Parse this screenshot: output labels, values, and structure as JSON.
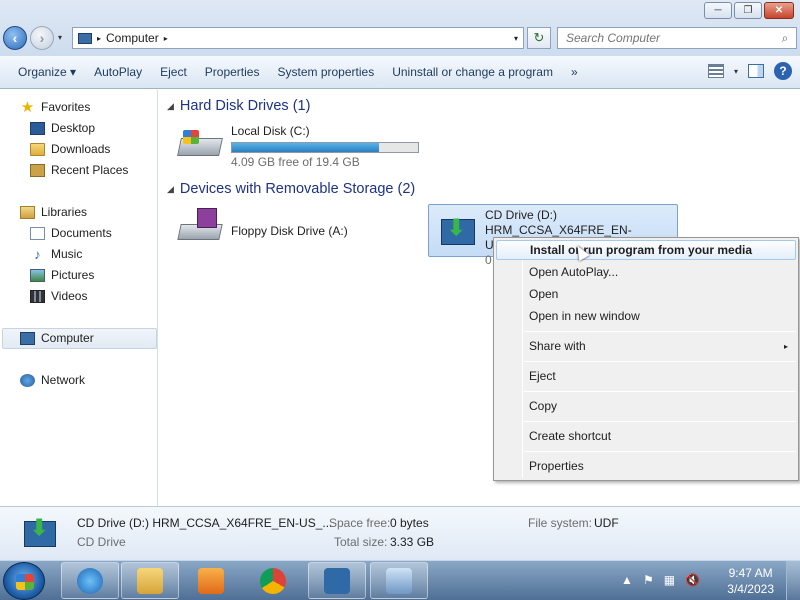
{
  "window": {
    "minimize": "─",
    "maximize": "❐",
    "close": "✕"
  },
  "nav": {
    "back": "‹",
    "forward": "›",
    "dropdown": "▾"
  },
  "address": {
    "separator": "▸",
    "crumb": "Computer",
    "crumb_arrow": "▸",
    "dropdown": "▾",
    "refresh": "↻"
  },
  "search": {
    "placeholder": "Search Computer",
    "icon": "⌕"
  },
  "toolbar": {
    "organize": "Organize ▾",
    "autoplay": "AutoPlay",
    "eject": "Eject",
    "properties": "Properties",
    "system_properties": "System properties",
    "uninstall": "Uninstall or change a program",
    "more": "»",
    "view_dropdown": "▾",
    "help": "?"
  },
  "sidebar": {
    "favorites": "Favorites",
    "desktop": "Desktop",
    "downloads": "Downloads",
    "recent_places": "Recent Places",
    "libraries": "Libraries",
    "documents": "Documents",
    "music": "Music",
    "pictures": "Pictures",
    "videos": "Videos",
    "computer": "Computer",
    "network": "Network"
  },
  "groups": {
    "hard_disk": "Hard Disk Drives (1)",
    "removable": "Devices with Removable Storage (2)",
    "toggle": "◢"
  },
  "drives": {
    "local_disk": {
      "name": "Local Disk (C:)",
      "free": "4.09 GB free of 19.4 GB",
      "used_fraction": 0.79
    },
    "floppy": {
      "name": "Floppy Disk Drive (A:)"
    },
    "cd": {
      "name": "CD Drive (D:)",
      "label": "HRM_CCSA_X64FRE_EN-US_DV5",
      "free_partial": "0"
    }
  },
  "context_menu": {
    "install_run": "Install or run program from your media",
    "open_autoplay": "Open AutoPlay...",
    "open": "Open",
    "open_new_window": "Open in new window",
    "share_with": "Share with",
    "share_arrow": "▸",
    "eject": "Eject",
    "copy": "Copy",
    "create_shortcut": "Create shortcut",
    "properties": "Properties"
  },
  "details": {
    "name": "CD Drive (D:) HRM_CCSA_X64FRE_EN-US_...",
    "type": "CD Drive",
    "space_free_label": "Space free:",
    "space_free_value": "0 bytes",
    "total_size_label": "Total size:",
    "total_size_value": "3.33 GB",
    "file_system_label": "File system:",
    "file_system_value": "UDF"
  },
  "taskbar": {
    "tray_show_hidden": "▲",
    "time": "9:47 AM",
    "date": "3/4/2023"
  },
  "colors": {
    "accent": "#2a7fc0",
    "group_header": "#1e3287"
  }
}
